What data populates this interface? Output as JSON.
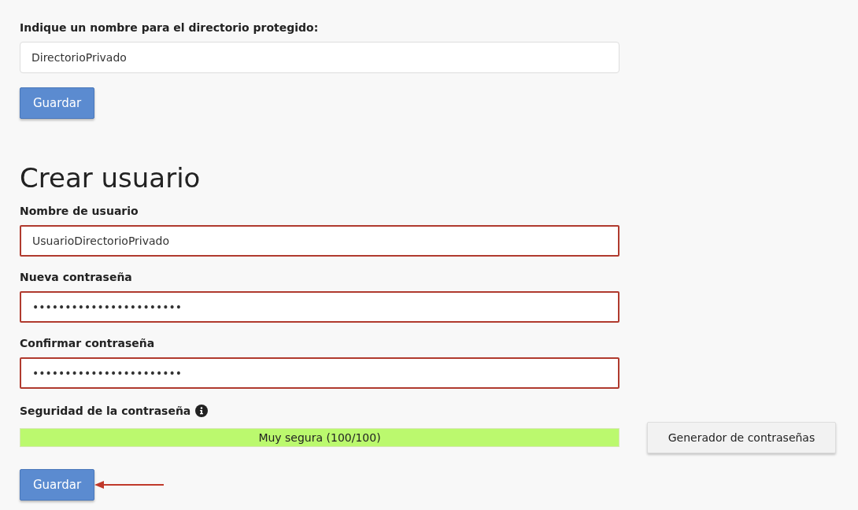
{
  "directory": {
    "label": "Indique un nombre para el directorio protegido:",
    "value": "DirectorioPrivado",
    "button": "Guardar"
  },
  "create_user": {
    "title": "Crear usuario",
    "fields": [
      {
        "label": "Nombre de usuario",
        "value": "UsuarioDirectorioPrivado",
        "highlighted": true
      },
      {
        "label": "Nueva contraseña",
        "value": "•••••••••••••••••••••••",
        "highlighted": true
      },
      {
        "label": "Confirmar contraseña",
        "value": "•••••••••••••••••••••••",
        "highlighted": true
      }
    ],
    "strength": {
      "label": "Seguridad de la contraseña",
      "level": 1,
      "reading": "Muy segura (100/100)"
    },
    "generator_button": "Generador de contraseñas",
    "save_button": "Guardar",
    "save_arrow": true
  }
}
